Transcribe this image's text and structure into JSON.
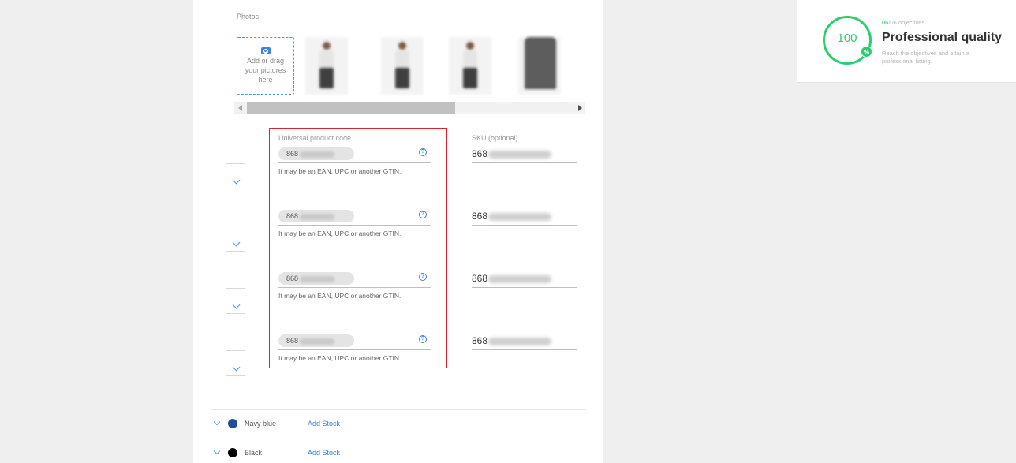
{
  "photos": {
    "label": "Photos",
    "upload_text": "Add or drag your pictures here",
    "thumbnails": [
      "photo-1",
      "photo-2",
      "photo-3",
      "photo-4"
    ]
  },
  "variants_table": {
    "upc_header": "Universal product code",
    "sku_header": "SKU (optional)",
    "rows": [
      {
        "upc_prefix": "868",
        "upc_hint": "It may be an EAN, UPC or another GTIN.",
        "sku_prefix": "868"
      },
      {
        "upc_prefix": "868",
        "upc_hint": "It may be an EAN, UPC or another GTIN.",
        "sku_prefix": "868"
      },
      {
        "upc_prefix": "868",
        "upc_hint": "It may be an EAN, UPC or another GTIN.",
        "sku_prefix": "868"
      },
      {
        "upc_prefix": "868",
        "upc_hint": "It may be an EAN, UPC or another GTIN.",
        "sku_prefix": "868"
      }
    ]
  },
  "colors": [
    {
      "name": "Navy blue",
      "swatch": "#1f4e96",
      "action": "Add Stock"
    },
    {
      "name": "Black",
      "swatch": "#000000",
      "action": "Add Stock"
    }
  ],
  "quality": {
    "score": "100",
    "badge": "%",
    "objectives_done": "06",
    "objectives_total": "/06 objectives",
    "title": "Professional quality",
    "subtitle": "Reach the objectives and attain a professional listing."
  },
  "theme": {
    "accent_blue": "#2f7ed8",
    "highlight_red": "#d9262c",
    "success_green": "#2ecc71"
  }
}
